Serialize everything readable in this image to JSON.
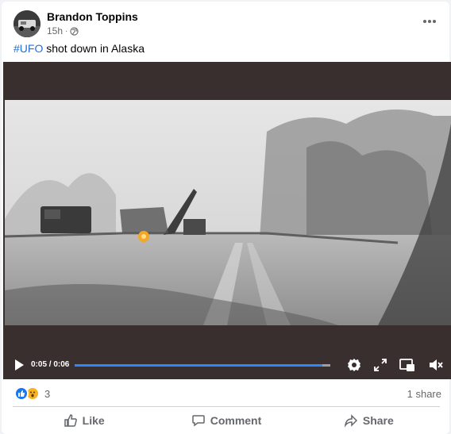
{
  "post": {
    "author": "Brandon Toppins",
    "time": "15h",
    "dot": "·",
    "audience_icon": "globe-icon",
    "hashtag": "#UFO",
    "caption": "shot down in Alaska"
  },
  "video": {
    "time_display": "0:05 / 0:06",
    "progress": 0.97,
    "accent_color": "#2d88ff"
  },
  "footer": {
    "reaction_count": "3",
    "shares": "1 share",
    "like_label": "Like",
    "comment_label": "Comment",
    "share_label": "Share"
  },
  "colors": {
    "hashtag": "#216fdb",
    "secondary_text": "#65676b"
  }
}
